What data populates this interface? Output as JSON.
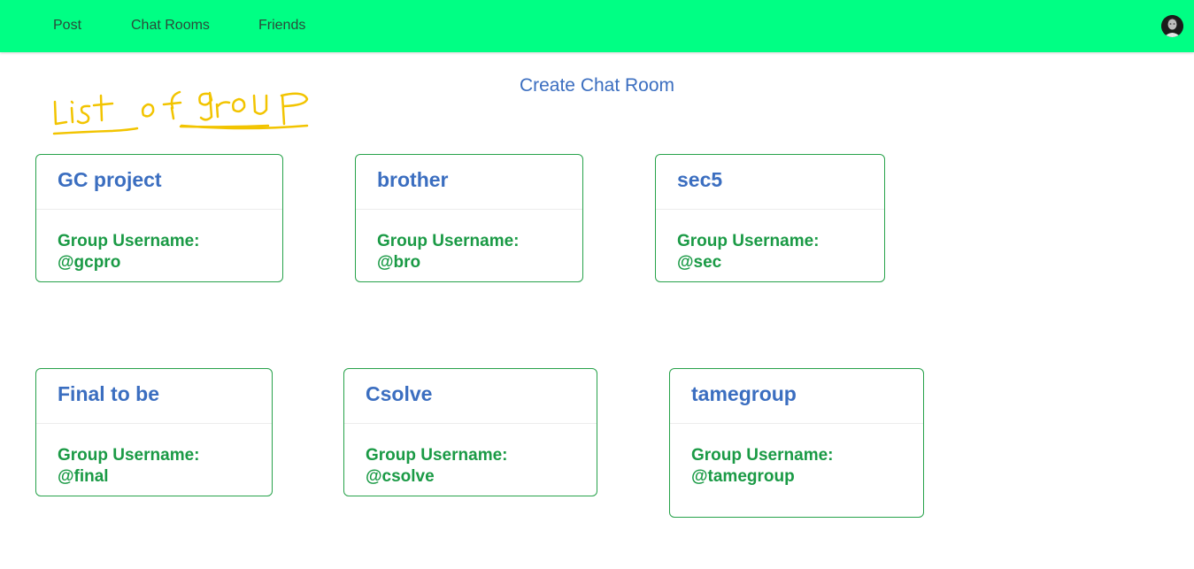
{
  "colors": {
    "navbar_bg": "#00ff84",
    "nav_text": "#2b4a3a",
    "link_blue": "#3b6ec0",
    "card_border": "#27a24a",
    "username_green": "#1a9a45",
    "scribble_yellow": "#f2c400"
  },
  "nav": {
    "items": [
      {
        "label": "Post"
      },
      {
        "label": "Chat Rooms"
      },
      {
        "label": "Friends"
      }
    ],
    "avatar_icon": "user-avatar-photo"
  },
  "create_chat_room_label": "Create Chat Room",
  "annotation_text": "list of group",
  "groups": [
    {
      "title": "GC project",
      "username_label": "Group Username:",
      "username": "@gcpro"
    },
    {
      "title": "brother",
      "username_label": "Group Username:",
      "username": "@bro"
    },
    {
      "title": "sec5",
      "username_label": "Group Username:",
      "username": "@sec"
    },
    {
      "title": "Final to be",
      "username_label": "Group Username:",
      "username": "@final"
    },
    {
      "title": "Csolve",
      "username_label": "Group Username:",
      "username": "@csolve"
    },
    {
      "title": "tamegroup",
      "username_label": "Group Username:",
      "username": "@tamegroup"
    }
  ]
}
